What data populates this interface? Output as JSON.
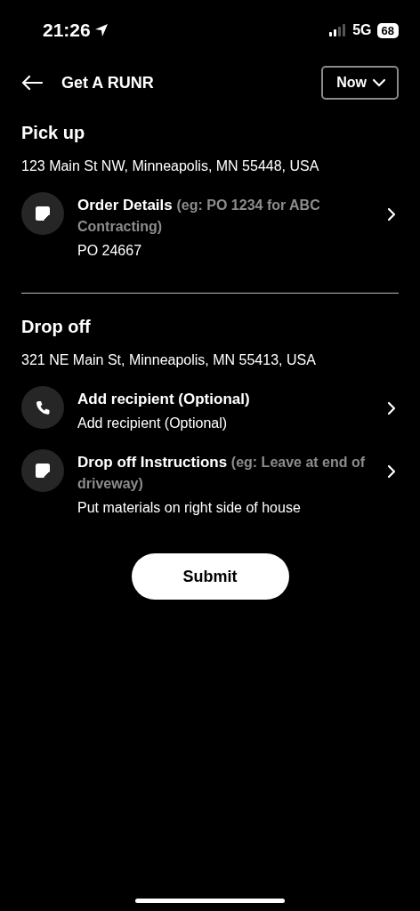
{
  "status_bar": {
    "time": "21:26",
    "network": "5G",
    "battery": "68"
  },
  "header": {
    "title": "Get A RUNR",
    "schedule": "Now"
  },
  "sections": [
    {
      "title": "Pick up",
      "address": "123 Main St NW, Minneapolis, MN 55448, USA",
      "rows": [
        {
          "kind": "note",
          "title": "Order Details",
          "hint": "(eg: PO 1234 for ABC Contracting)",
          "value": "PO 24667"
        }
      ]
    },
    {
      "title": "Drop off",
      "address": "321 NE Main St, Minneapolis, MN 55413, USA",
      "rows": [
        {
          "kind": "phone",
          "title": "Add recipient (Optional)",
          "value": "Add recipient (Optional)"
        },
        {
          "kind": "note",
          "title": "Drop off Instructions",
          "hint": "(eg: Leave at end of driveway)",
          "value": "Put materials on right side of house"
        }
      ]
    }
  ],
  "submit": "Submit"
}
